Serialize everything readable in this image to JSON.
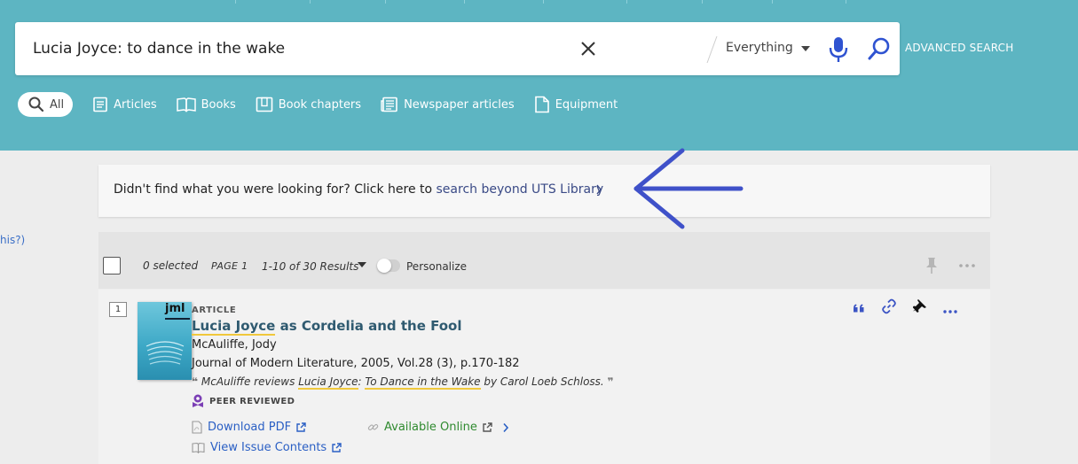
{
  "search": {
    "query": "Lucia Joyce: to dance in the wake",
    "scope": "Everything",
    "advanced_label": "ADVANCED SEARCH"
  },
  "tabs": [
    {
      "label": "All",
      "icon": "search-icon"
    },
    {
      "label": "Articles",
      "icon": "article-icon"
    },
    {
      "label": "Books",
      "icon": "book-icon"
    },
    {
      "label": "Book chapters",
      "icon": "book-chapter-icon"
    },
    {
      "label": "Newspaper articles",
      "icon": "newspaper-icon"
    },
    {
      "label": "Equipment",
      "icon": "document-icon"
    }
  ],
  "banner": {
    "text": "Didn't find what you were looking for? Click here to ",
    "link": "search beyond UTS Library"
  },
  "left_edge_text": "his?)",
  "results_bar": {
    "selected": "0 selected",
    "page": "PAGE 1",
    "range": "1-10 of 30 Results",
    "personalize": "Personalize"
  },
  "result": {
    "number": "1",
    "cover_text": "jml",
    "type": "ARTICLE",
    "title_highlight": "Lucia Joyce",
    "title_rest": " as Cordelia and the Fool",
    "author": "McAuliffe, Jody",
    "source": "Journal of Modern Literature, 2005, Vol.28 (3), p.170-182",
    "snippet_pre": "McAuliffe reviews ",
    "snippet_hl1": "Lucia Joyce",
    "snippet_mid1": ": ",
    "snippet_hl2": "To Dance in the Wake",
    "snippet_post": " by Carol Loeb Schloss.",
    "peer_reviewed": "PEER REVIEWED",
    "download_pdf": "Download PDF",
    "view_issue": "View Issue Contents",
    "available_online": "Available Online"
  },
  "colors": {
    "header": "#5db5c2",
    "link_blue": "#2a5fc4",
    "online_green": "#2f8a2f",
    "action_blue": "#3b54c4",
    "highlight": "#f0c83c",
    "arrow": "#3f51c9"
  }
}
